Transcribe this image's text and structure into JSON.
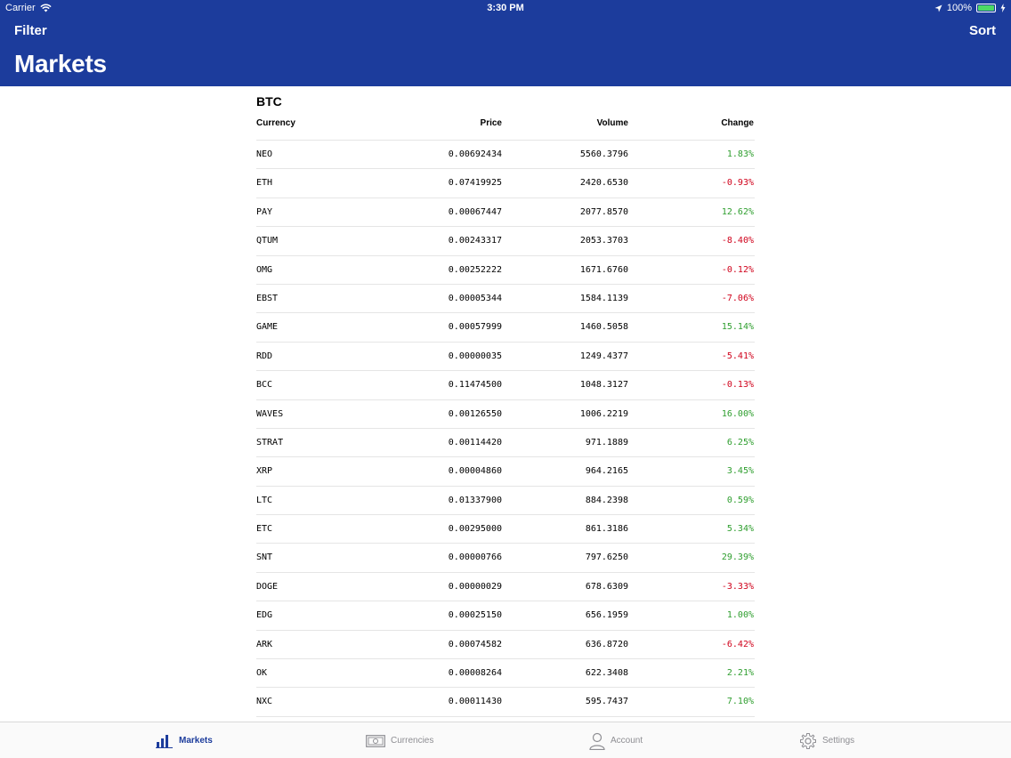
{
  "status_bar": {
    "carrier": "Carrier",
    "time": "3:30 PM",
    "battery": "100%"
  },
  "nav": {
    "filter_label": "Filter",
    "sort_label": "Sort",
    "title": "Markets"
  },
  "market": {
    "section": "BTC",
    "columns": {
      "currency": "Currency",
      "price": "Price",
      "volume": "Volume",
      "change": "Change"
    },
    "rows": [
      {
        "currency": "NEO",
        "price": "0.00692434",
        "volume": "5560.3796",
        "change": "1.83%"
      },
      {
        "currency": "ETH",
        "price": "0.07419925",
        "volume": "2420.6530",
        "change": "-0.93%"
      },
      {
        "currency": "PAY",
        "price": "0.00067447",
        "volume": "2077.8570",
        "change": "12.62%"
      },
      {
        "currency": "QTUM",
        "price": "0.00243317",
        "volume": "2053.3703",
        "change": "-8.40%"
      },
      {
        "currency": "OMG",
        "price": "0.00252222",
        "volume": "1671.6760",
        "change": "-0.12%"
      },
      {
        "currency": "EBST",
        "price": "0.00005344",
        "volume": "1584.1139",
        "change": "-7.06%"
      },
      {
        "currency": "GAME",
        "price": "0.00057999",
        "volume": "1460.5058",
        "change": "15.14%"
      },
      {
        "currency": "RDD",
        "price": "0.00000035",
        "volume": "1249.4377",
        "change": "-5.41%"
      },
      {
        "currency": "BCC",
        "price": "0.11474500",
        "volume": "1048.3127",
        "change": "-0.13%"
      },
      {
        "currency": "WAVES",
        "price": "0.00126550",
        "volume": "1006.2219",
        "change": "16.00%"
      },
      {
        "currency": "STRAT",
        "price": "0.00114420",
        "volume": "971.1889",
        "change": "6.25%"
      },
      {
        "currency": "XRP",
        "price": "0.00004860",
        "volume": "964.2165",
        "change": "3.45%"
      },
      {
        "currency": "LTC",
        "price": "0.01337900",
        "volume": "884.2398",
        "change": "0.59%"
      },
      {
        "currency": "ETC",
        "price": "0.00295000",
        "volume": "861.3186",
        "change": "5.34%"
      },
      {
        "currency": "SNT",
        "price": "0.00000766",
        "volume": "797.6250",
        "change": "29.39%"
      },
      {
        "currency": "DOGE",
        "price": "0.00000029",
        "volume": "678.6309",
        "change": "-3.33%"
      },
      {
        "currency": "EDG",
        "price": "0.00025150",
        "volume": "656.1959",
        "change": "1.00%"
      },
      {
        "currency": "ARK",
        "price": "0.00074582",
        "volume": "636.8720",
        "change": "-6.42%"
      },
      {
        "currency": "OK",
        "price": "0.00008264",
        "volume": "622.3408",
        "change": "2.21%"
      },
      {
        "currency": "NXC",
        "price": "0.00011430",
        "volume": "595.7437",
        "change": "7.10%"
      },
      {
        "currency": "",
        "price": "",
        "volume": "",
        "change": ""
      }
    ]
  },
  "tabs": [
    {
      "label": "Markets",
      "icon": "bar-chart-icon",
      "active": true
    },
    {
      "label": "Currencies",
      "icon": "banknote-icon",
      "active": false
    },
    {
      "label": "Account",
      "icon": "person-icon",
      "active": false
    },
    {
      "label": "Settings",
      "icon": "gear-icon",
      "active": false
    }
  ],
  "colors": {
    "brand": "#1c3c9c",
    "positive": "#2e9e2e",
    "negative": "#d0021b",
    "battery": "#4cd964"
  }
}
